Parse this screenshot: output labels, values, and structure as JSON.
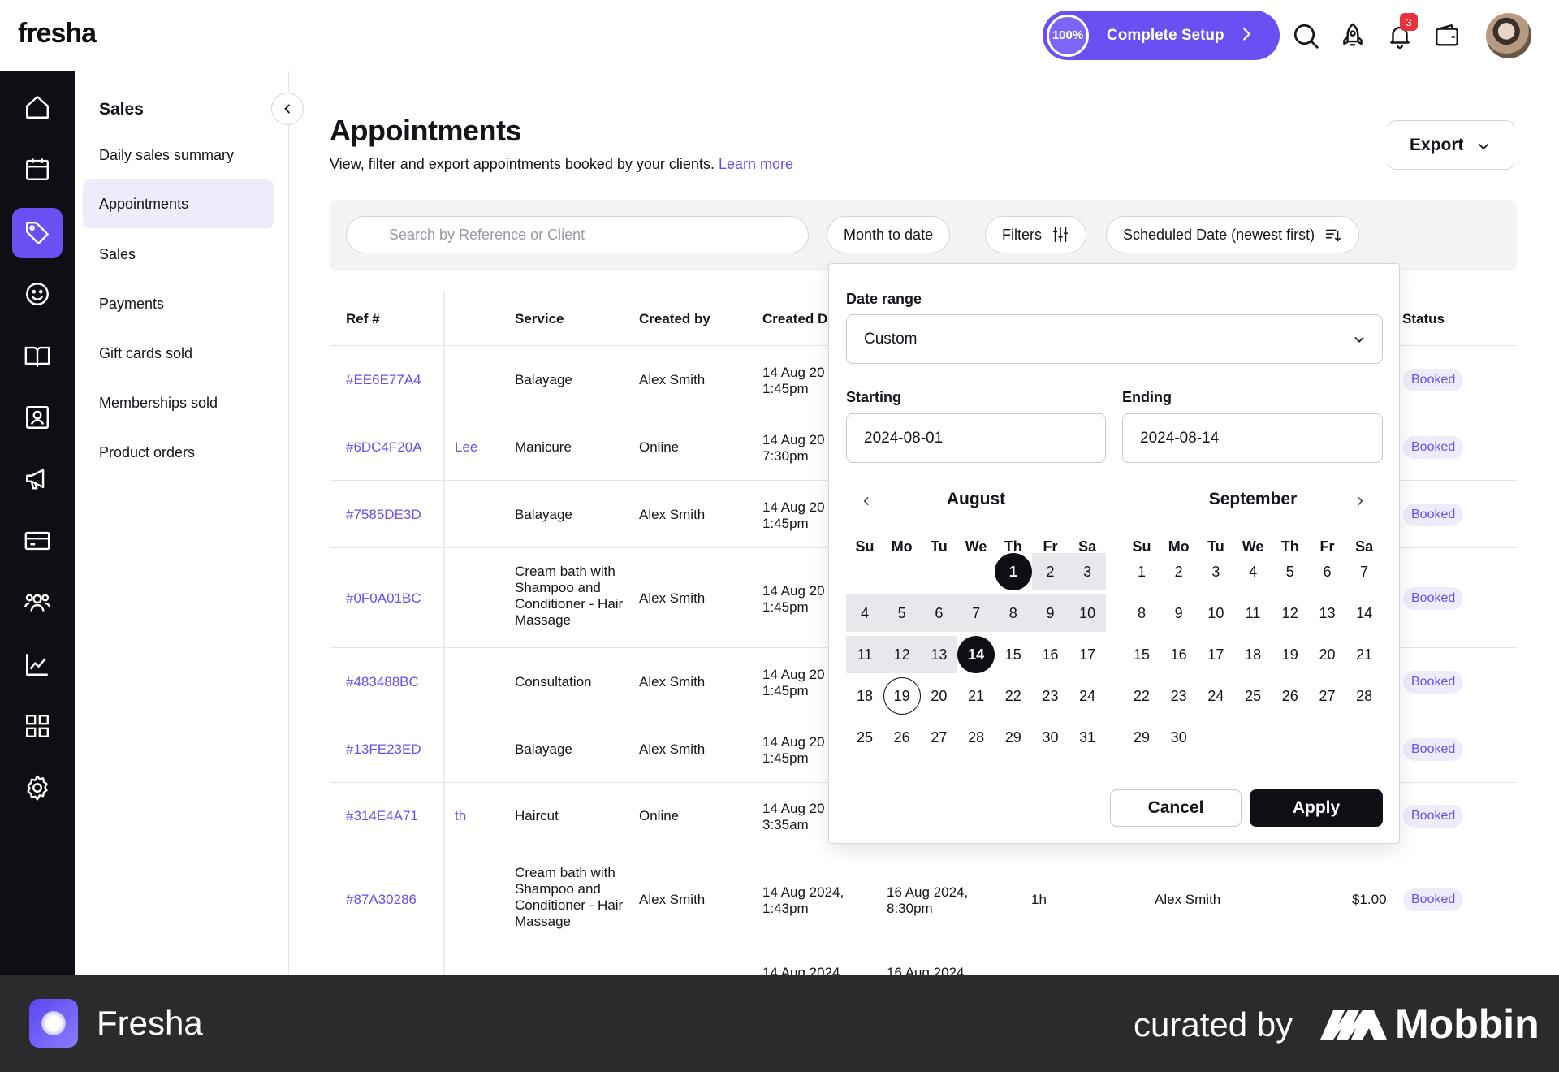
{
  "topbar": {
    "logo": "fresha",
    "setup_percent": "100%",
    "setup_label": "Complete Setup",
    "notification_count": "3"
  },
  "subnav": {
    "title": "Sales",
    "items": [
      {
        "label": "Daily sales summary"
      },
      {
        "label": "Appointments"
      },
      {
        "label": "Sales"
      },
      {
        "label": "Payments"
      },
      {
        "label": "Gift cards sold"
      },
      {
        "label": "Memberships sold"
      },
      {
        "label": "Product orders"
      }
    ]
  },
  "page": {
    "title": "Appointments",
    "subtitle": "View, filter and export appointments booked by your clients.",
    "learn_more": "Learn more",
    "export_label": "Export"
  },
  "filters": {
    "search_placeholder": "Search by Reference or Client",
    "period": "Month to date",
    "filters_label": "Filters",
    "sort_label": "Scheduled Date (newest first)"
  },
  "table": {
    "headers": {
      "ref": "Ref #",
      "service": "Service",
      "created_by": "Created by",
      "created_date": "Created D",
      "status": "Status"
    },
    "rows": [
      {
        "ref": "#EE6E77A4",
        "client": "",
        "service": "Balayage",
        "created_by": "Alex Smith",
        "created_line1": "14 Aug 20",
        "created_line2": "1:45pm",
        "status": "Booked"
      },
      {
        "ref": "#6DC4F20A",
        "client": "Lee",
        "service": "Manicure",
        "created_by": "Online",
        "created_line1": "14 Aug 20",
        "created_line2": "7:30pm",
        "status": "Booked"
      },
      {
        "ref": "#7585DE3D",
        "client": "",
        "service": "Balayage",
        "created_by": "Alex Smith",
        "created_line1": "14 Aug 20",
        "created_line2": "1:45pm",
        "status": "Booked"
      },
      {
        "ref": "#0F0A01BC",
        "client": "",
        "service": "Cream bath with Shampoo and Conditioner - Hair Massage",
        "created_by": "Alex Smith",
        "created_line1": "14 Aug 20",
        "created_line2": "1:45pm",
        "status": "Booked"
      },
      {
        "ref": "#483488BC",
        "client": "",
        "service": "Consultation",
        "created_by": "Alex Smith",
        "created_line1": "14 Aug 20",
        "created_line2": "1:45pm",
        "status": "Booked"
      },
      {
        "ref": "#13FE23ED",
        "client": "",
        "service": "Balayage",
        "created_by": "Alex Smith",
        "created_line1": "14 Aug 20",
        "created_line2": "1:45pm",
        "status": "Booked"
      },
      {
        "ref": "#314E4A71",
        "client": "th",
        "service": "Haircut",
        "created_by": "Online",
        "created_line1": "14 Aug 20",
        "created_line2": "3:35am",
        "status": "Booked"
      },
      {
        "ref": "#87A30286",
        "client": "",
        "service": "Cream bath with Shampoo and Conditioner - Hair Massage",
        "created_by": "Alex Smith",
        "created_line1": "14 Aug 2024,",
        "created_line2": "1:43pm",
        "scheduled_line1": "16 Aug 2024,",
        "scheduled_line2": "8:30pm",
        "duration": "1h",
        "team_member": "Alex Smith",
        "price": "$1.00",
        "status": "Booked"
      }
    ],
    "partial_row": {
      "created": "14 Aug 2024",
      "scheduled": "16 Aug 2024"
    }
  },
  "picker": {
    "date_range_label": "Date range",
    "date_range_value": "Custom",
    "starting_label": "Starting",
    "starting_value": "2024-08-01",
    "ending_label": "Ending",
    "ending_value": "2024-08-14",
    "weekdays": [
      "Su",
      "Mo",
      "Tu",
      "We",
      "Th",
      "Fr",
      "Sa"
    ],
    "months": [
      {
        "name": "August",
        "first_weekday": 4,
        "days": 31
      },
      {
        "name": "September",
        "first_weekday": 0,
        "days": 30
      }
    ],
    "range_start": 1,
    "range_end": 14,
    "today": 19,
    "cancel_label": "Cancel",
    "apply_label": "Apply"
  },
  "banner": {
    "app_name": "Fresha",
    "curated_by": "curated by",
    "brand": "Mobbin"
  }
}
